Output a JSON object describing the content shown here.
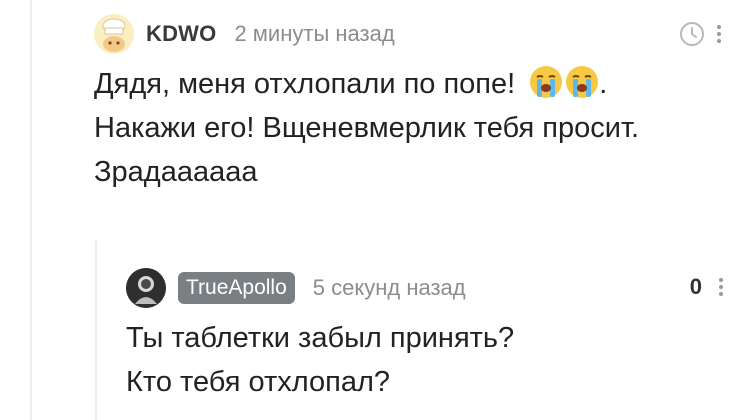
{
  "comments": [
    {
      "author": "KDWO",
      "time": "2 минуты назад",
      "lines": [
        "Дядя, меня отхлопали по попе!",
        ".",
        "Накажи его! Вщеневмерлик тебя просит.",
        "Зрадаааааа"
      ],
      "emoji": [
        "loudly-crying-face",
        "loudly-crying-face"
      ]
    },
    {
      "author": "TrueApollo",
      "time": "5 секунд назад",
      "score": "0",
      "lines": [
        "Ты таблетки забыл принять?",
        "Кто тебя отхлопал?"
      ]
    }
  ],
  "colors": {
    "author_badge": "#7a7f83",
    "muted_text": "#8c8c8c",
    "thread_line": "#ececec"
  }
}
